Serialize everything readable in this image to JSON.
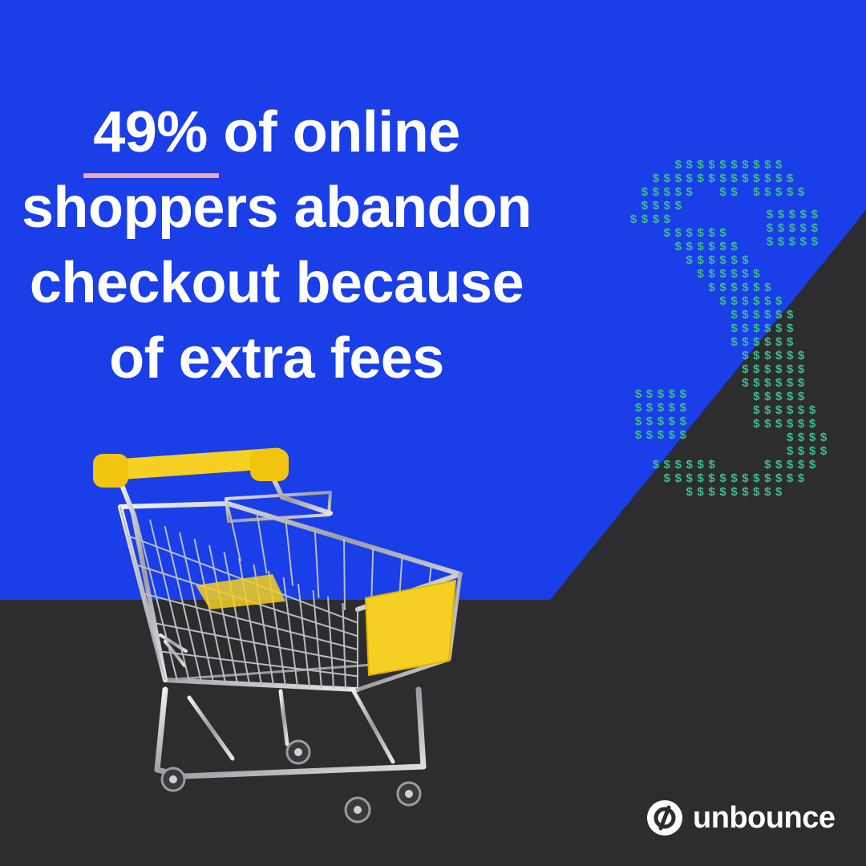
{
  "headline": {
    "highlight": "49%",
    "line1_rest": " of online",
    "line2": "shoppers abandon",
    "line3": "checkout because",
    "line4": "of extra fees"
  },
  "brand": {
    "name": "unbounce"
  },
  "dollar_glyph": "$",
  "colors": {
    "blue": "#1a3ee8",
    "dark": "#2d2d2f",
    "dollar_green": "#3bbf8a",
    "underline_pink": "#f4a3b0",
    "cart_yellow": "#f5cf21"
  },
  "icons": [
    "dollar-sign-pattern",
    "shopping-cart",
    "unbounce-logo-icon"
  ]
}
